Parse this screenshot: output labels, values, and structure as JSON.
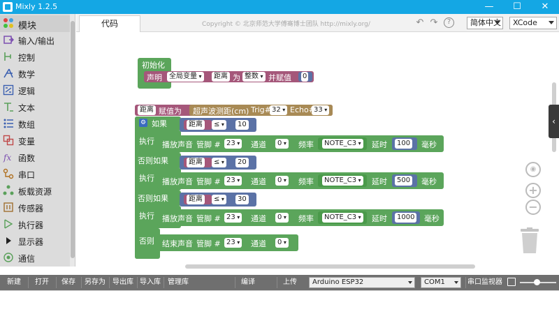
{
  "window": {
    "title": "Mixly 1.2.5",
    "minimize": "—",
    "maximize": "☐",
    "close": "✕"
  },
  "sidebar": {
    "items": [
      {
        "label": "模块",
        "icon": "puzzle-icon",
        "color": "#e0a020"
      },
      {
        "label": "输入/输出",
        "icon": "io-icon",
        "color": "#7c4fb0"
      },
      {
        "label": "控制",
        "icon": "control-icon",
        "color": "#5aa05a"
      },
      {
        "label": "数学",
        "icon": "math-icon",
        "color": "#3a5fb0"
      },
      {
        "label": "逻辑",
        "icon": "logic-icon",
        "color": "#3a5fb0"
      },
      {
        "label": "文本",
        "icon": "text-icon",
        "color": "#5aa05a"
      },
      {
        "label": "数组",
        "icon": "array-icon",
        "color": "#3a5fb0"
      },
      {
        "label": "变量",
        "icon": "variable-icon",
        "color": "#c04a4a"
      },
      {
        "label": "函数",
        "icon": "function-icon",
        "color": "#7c4fb0"
      },
      {
        "label": "串口",
        "icon": "serial-icon",
        "color": "#b07020"
      },
      {
        "label": "板载资源",
        "icon": "board-icon",
        "color": "#5aa05a"
      },
      {
        "label": "传感器",
        "icon": "sensor-icon",
        "color": "#a07030"
      },
      {
        "label": "执行器",
        "icon": "actuator-icon",
        "color": "#5aa05a"
      },
      {
        "label": "显示器",
        "icon": "display-icon",
        "color": "#222222"
      },
      {
        "label": "通信",
        "icon": "comm-icon",
        "color": "#5aa05a"
      }
    ]
  },
  "tabs": {
    "code": "代码"
  },
  "copyright": "Copyright © 北京师范大学傅骞博士团队 http://mixly.org/",
  "toolbar": {
    "language": "简体中文",
    "theme": "XCode"
  },
  "blocks": {
    "init": {
      "header": "初始化",
      "declare": "声明",
      "scope": "全局变量",
      "var": "距离",
      "as": "为",
      "type": "整数",
      "assign": "并赋值",
      "value": "0"
    },
    "assign": {
      "var": "距离",
      "label": "赋值为",
      "sensor": "超声波测距(cm)",
      "trig_label": "Trig#",
      "trig": "32",
      "echo_label": "Echo#",
      "echo": "33"
    },
    "if": {
      "if_label": "如果",
      "do_label": "执行",
      "elseif_label": "否则如果",
      "else_label": "否则",
      "op": "≤",
      "conditions": [
        {
          "var": "距离",
          "value": "10"
        },
        {
          "var": "距离",
          "value": "20"
        },
        {
          "var": "距离",
          "value": "30"
        }
      ],
      "tone": {
        "play": "播放声音",
        "pin_label": "管脚 #",
        "pin": "23",
        "channel_label": "通道",
        "channel": "0",
        "freq_label": "频率",
        "delay_label": "延时",
        "unit": "毫秒"
      },
      "tones": [
        {
          "note": "NOTE_C3",
          "delay": "100"
        },
        {
          "note": "NOTE_C3",
          "delay": "500"
        },
        {
          "note": "NOTE_C3",
          "delay": "1000"
        }
      ],
      "stop": {
        "label": "结束声音",
        "pin_label": "管脚 #",
        "pin": "23",
        "channel_label": "通道",
        "channel": "0"
      }
    }
  },
  "bottom": {
    "new": "新建",
    "open": "打开",
    "save": "保存",
    "save_as": "另存为",
    "export": "导出库",
    "import": "导入库",
    "manage": "管理库",
    "compile": "编译",
    "upload": "上传",
    "board": "Arduino ESP32",
    "port": "COM1",
    "monitor": "串口监视器"
  },
  "colors": {
    "titlebar": "#14a7e4",
    "variable_block": "#a5577a",
    "logic_block": "#5b72a6",
    "control_block": "#5ba55b",
    "sensor_block": "#a88a55",
    "actuator_block": "#5ba55b"
  }
}
